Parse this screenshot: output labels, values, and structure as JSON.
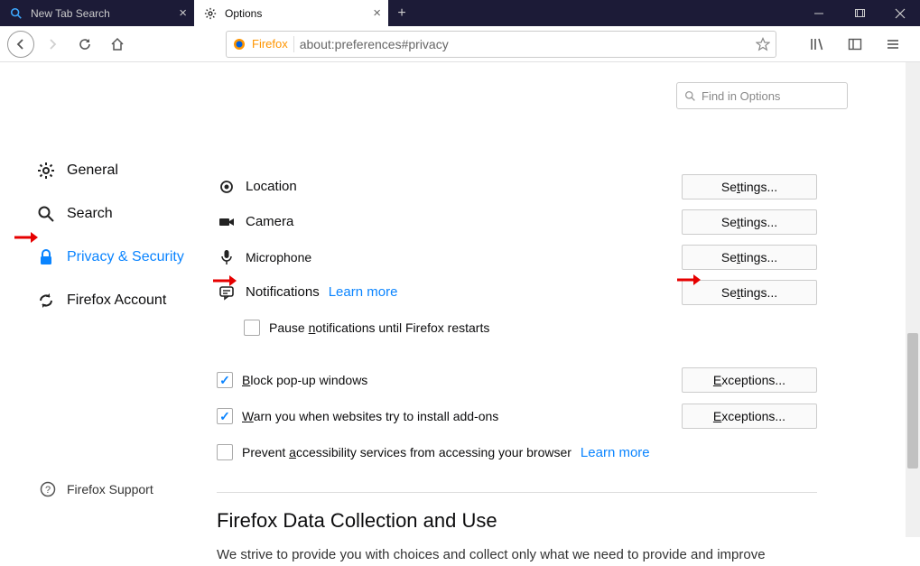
{
  "tabs": [
    {
      "label": "New Tab Search"
    },
    {
      "label": "Options"
    }
  ],
  "urlbar": {
    "identity": "Firefox",
    "url": "about:preferences#privacy"
  },
  "find": {
    "placeholder": "Find in Options"
  },
  "sidebar": {
    "items": [
      {
        "label": "General"
      },
      {
        "label": "Search"
      },
      {
        "label": "Privacy & Security"
      },
      {
        "label": "Firefox Account"
      }
    ],
    "support": "Firefox Support"
  },
  "permissions": {
    "heading_partial": "",
    "location": "Location",
    "camera": "Camera",
    "microphone": "Microphone",
    "notifications": "Notifications",
    "learn_more": "Learn more",
    "settings_btn": "Settings...",
    "pause": "Pause notifications until Firefox restarts",
    "block_popup": "Block pop-up windows",
    "warn_addons": "Warn you when websites try to install add-ons",
    "prevent_a11y": "Prevent accessibility services from accessing your browser",
    "exceptions_btn": "Exceptions..."
  },
  "data_section": {
    "heading": "Firefox Data Collection and Use",
    "para": "We strive to provide you with choices and collect only what we need to provide and improve"
  }
}
